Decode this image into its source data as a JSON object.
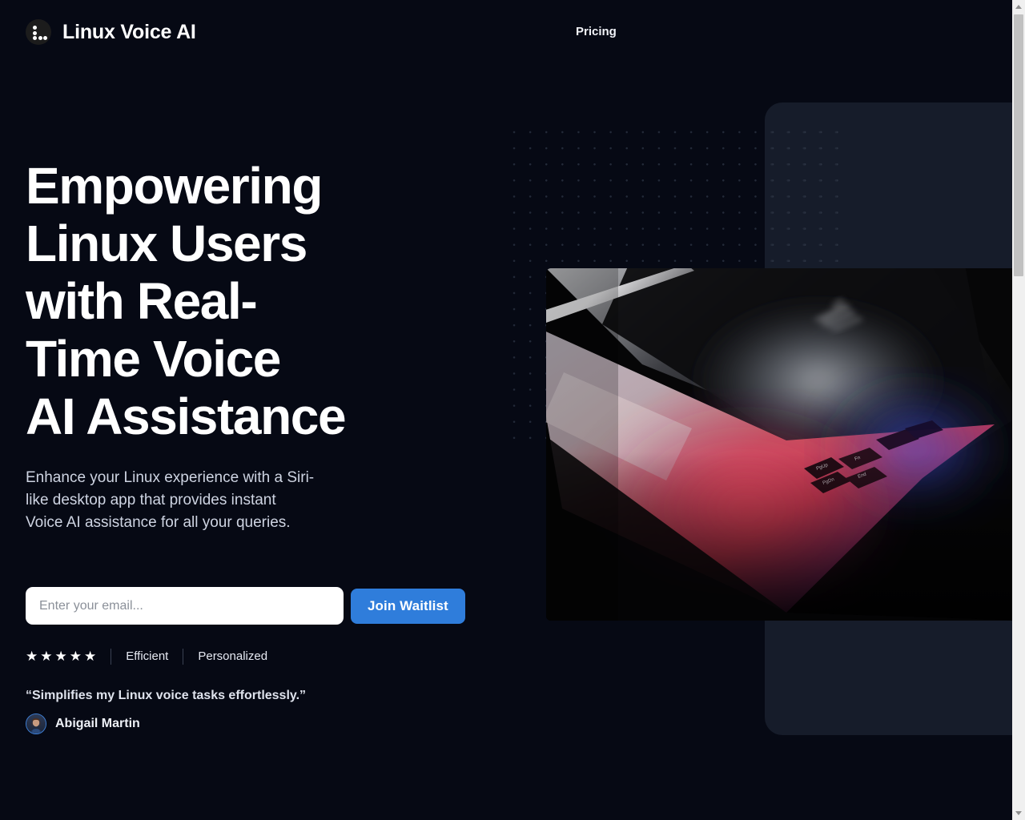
{
  "theme": {
    "background": "#060914",
    "panel": "#161c2a",
    "accent": "#2f7ddb",
    "text_primary": "#ffffff",
    "text_muted": "#ced4e2",
    "dot_grid": "#232a39"
  },
  "header": {
    "brand_name": "Linux Voice AI",
    "logo_icon": "linux-dots-logo-icon",
    "nav": [
      {
        "label": "Pricing"
      }
    ]
  },
  "hero": {
    "headline": "Empowering\nLinux Users\nwith Real-\nTime Voice\nAI Assistance",
    "subhead": "Enhance your Linux experience with a Siri-\nlike desktop app that provides instant\nVoice AI assistance for all your queries."
  },
  "signup": {
    "email_placeholder": "Enter your email...",
    "email_value": "",
    "submit_label": "Join Waitlist"
  },
  "ratings": {
    "stars_icon": "star-icon",
    "stars_filled": 5,
    "star_glyph": "★",
    "tags": [
      "Efficient",
      "Personalized"
    ]
  },
  "testimonial": {
    "quote": "“Simplifies my Linux voice tasks effortlessly.”",
    "author": "Abigail Martin",
    "avatar_icon": "user-avatar-photo"
  },
  "visual": {
    "photo_alt": "laptop-with-rgb-backlit-keyboard",
    "dot_grid_icon": "dot-grid-pattern"
  },
  "scrollbar": {
    "up_arrow_icon": "scroll-up-arrow-icon",
    "down_arrow_icon": "scroll-down-arrow-icon",
    "thumb_icon": "scrollbar-thumb"
  }
}
